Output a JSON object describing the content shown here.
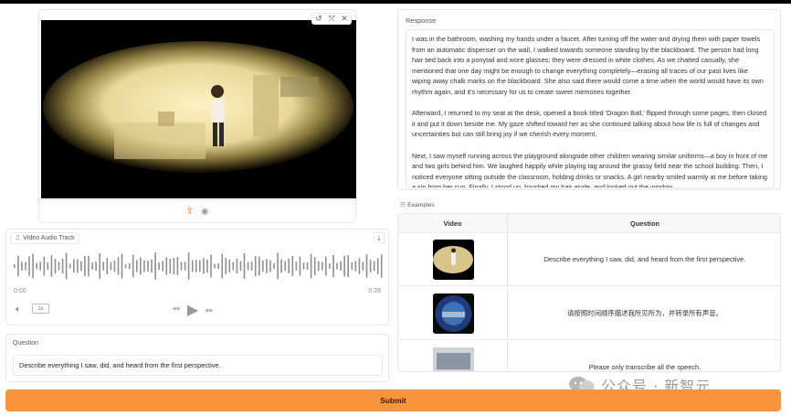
{
  "video": {
    "toolbar_icons": [
      "undo-icon",
      "share-icon",
      "close-icon"
    ],
    "bottom_icons": [
      "upload-icon",
      "webcam-icon"
    ]
  },
  "audio": {
    "label": "Video Audio Track",
    "time_start": "0:00",
    "time_end": "0:28",
    "speed": "1x"
  },
  "question": {
    "label": "Question",
    "value": "Describe everything I saw, did, and heard from the first perspective."
  },
  "response": {
    "label": "Response",
    "paragraphs": [
      "I was in the bathroom, washing my hands under a faucet. After turning off the water and drying them with paper towels from an automatic dispenser on the wall, I walked towards someone standing by the blackboard. The person had long hair tied back into a ponytail and wore glasses; they were dressed in white clothes. As we chatted casually, she mentioned that one day might be enough to change everything completely—erasing all traces of our past lives like wiping away chalk marks on the blackboard. She also said there would come a time when the world would have its own rhythm again, and it's necessary for us to create sweet memories together.",
      "Afterward, I returned to my seat at the desk, opened a book titled 'Dragon Ball,' flipped through some pages, then closed it and put it down beside me. My gaze shifted toward her as she continued talking about how life is full of changes and uncertainties but can still bring joy if we cherish every moment.",
      "Next, I saw myself running across the playground alongside other children wearing similar uniforms—a boy in front of me and two girls behind him. We laughed happily while playing tag around the grassy field near the school building. Then, I noticed everyone sitting outside the classroom, holding drinks or snacks. A girl nearby smiled warmly at me before taking a sip from her cup. Finally, I stood up, brushed my hair aside, and looked out the window"
    ]
  },
  "examples": {
    "label": "Examples",
    "col_video": "Video",
    "col_question": "Question",
    "rows": [
      {
        "question": "Describe everything I saw, did, and heard from the first perspective."
      },
      {
        "question": "请按照时间顺序描述我所见所为，并转录所有声音。"
      },
      {
        "question": "Please only transcribe all the speech."
      }
    ]
  },
  "submit_label": "Submit",
  "watermark": "公众号 · 新智元",
  "colors": {
    "accent": "#f9933c",
    "border": "#e5e7eb"
  }
}
